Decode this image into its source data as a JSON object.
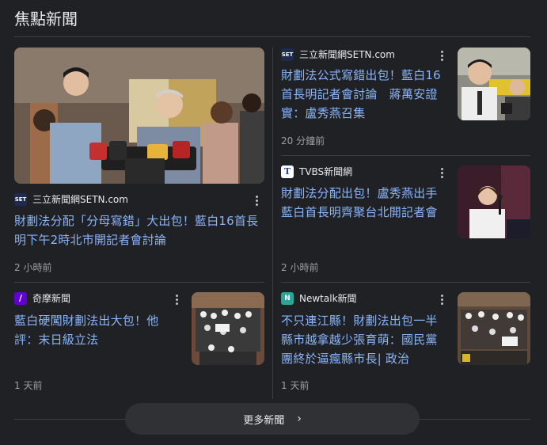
{
  "section": {
    "title": "焦點新聞"
  },
  "articles": [
    {
      "source": "三立新聞網SETN.com",
      "logo_text": "SET",
      "headline": "財劃法分配「分母寫錯」大出包！藍白16首長明下午2時北市開記者會討論",
      "time": "2 小時前",
      "image": "press-conference-photo"
    },
    {
      "source": "三立新聞網SETN.com",
      "logo_text": "SET",
      "headline": "財劃法公式寫錯出包！藍白16首長明記者會討論　蔣萬安證實：盧秀燕召集",
      "time": "20 分鐘前",
      "image": "politician-portrait-photo"
    },
    {
      "source": "TVBS新聞網",
      "logo_text": "T",
      "headline": "財劃法分配出包！盧秀燕出手　藍白首長明齊聚台北開記者會",
      "time": "2 小時前",
      "image": "speaker-podium-photo"
    },
    {
      "source": "奇摩新聞",
      "logo_text": "/",
      "headline": "藍白硬闖財劃法出大包！他評：末日級立法",
      "time": "1 天前",
      "image": "legislature-protest-photo"
    },
    {
      "source": "Newtalk新聞",
      "logo_text": "N",
      "headline": "不只連江縣！財劃法出包一半縣市越拿越少張育萌：國民黨團終於逼瘋縣市長| 政治",
      "time": "1 天前",
      "image": "legislature-chamber-photo"
    }
  ],
  "more": {
    "label": "更多新聞"
  },
  "colors": {
    "background": "#202124",
    "link": "#8ab4f8",
    "divider": "#3c4043",
    "muted": "#9aa0a6"
  }
}
